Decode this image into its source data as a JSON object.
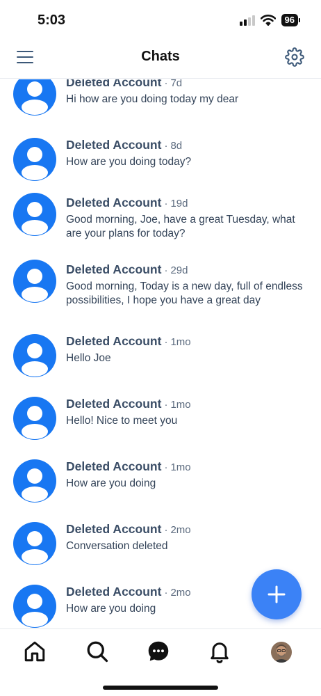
{
  "status_bar": {
    "time": "5:03",
    "battery": "96"
  },
  "header": {
    "title": "Chats"
  },
  "chats": [
    {
      "name": "Deleted Account",
      "time": "7d",
      "message": "Hi how are you doing today my dear"
    },
    {
      "name": "Deleted Account",
      "time": "8d",
      "message": "How are you doing today?"
    },
    {
      "name": "Deleted Account",
      "time": "19d",
      "message": "Good morning, Joe, have a great Tuesday, what are your plans for today?"
    },
    {
      "name": "Deleted Account",
      "time": "29d",
      "message": "Good morning, Today is a new day, full of endless possibilities, I hope you have a great day"
    },
    {
      "name": "Deleted Account",
      "time": "1mo",
      "message": "Hello Joe"
    },
    {
      "name": "Deleted Account",
      "time": "1mo",
      "message": "Hello! Nice to meet you"
    },
    {
      "name": "Deleted Account",
      "time": "1mo",
      "message": "How are you doing"
    },
    {
      "name": "Deleted Account",
      "time": "2mo",
      "message": "Conversation deleted"
    },
    {
      "name": "Deleted Account",
      "time": "2mo",
      "message": "How are you doing"
    }
  ],
  "separator": "·",
  "colors": {
    "accent": "#1877f2",
    "fab": "#3b82f6",
    "icon": "#3c5878",
    "text": "#334358"
  },
  "tabs": [
    "home-icon",
    "search-icon",
    "chat-bubble-icon",
    "bell-icon",
    "profile-avatar"
  ]
}
